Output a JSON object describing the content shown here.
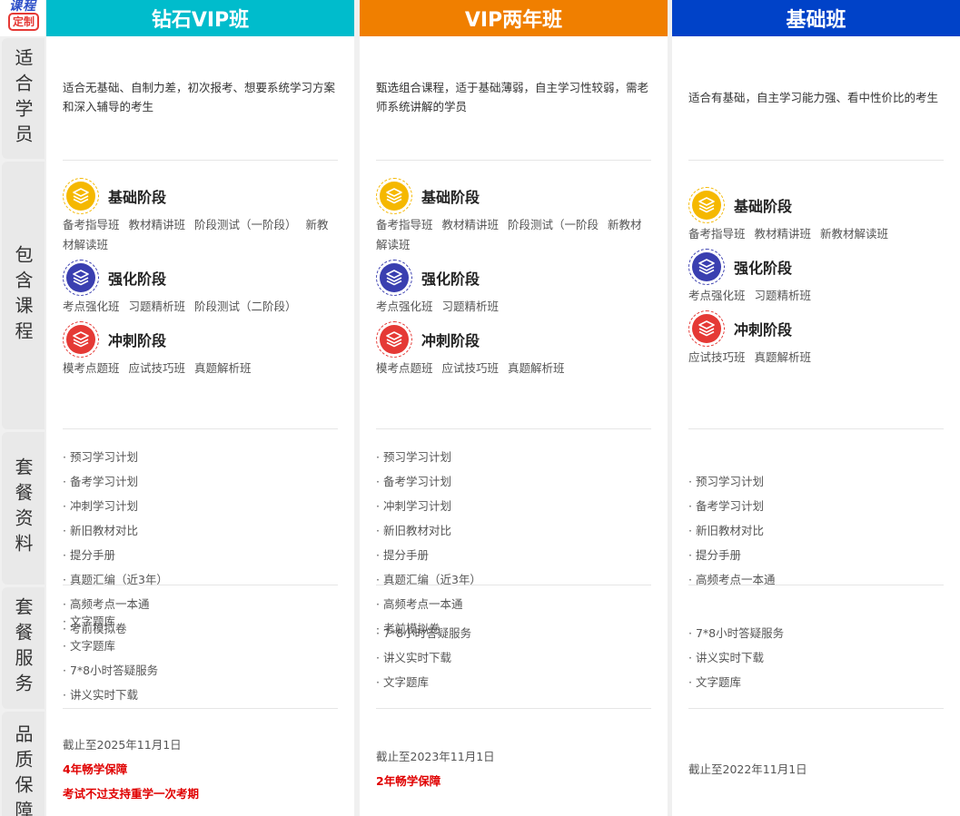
{
  "logo": {
    "top": "课程",
    "badge": "定制"
  },
  "row_labels": [
    "适合学员",
    "包含课程",
    "套餐资料",
    "套餐服务",
    "品质保障"
  ],
  "colors": {
    "diamond": "#00bccc",
    "vip": "#f07f00",
    "basic": "#0042c8",
    "stage1": "#f5b800",
    "stage2": "#3a3fb0",
    "stage3": "#e53935"
  },
  "plans": [
    {
      "name": "钻石VIP班",
      "desc": "适合无基础、自制力差，初次报考、想要系统学习方案和深入辅导的考生",
      "stages": [
        {
          "title": "基础阶段",
          "courses": [
            "备考指导班",
            "教材精讲班",
            "阶段测试（一阶段）",
            "新教材解读班"
          ]
        },
        {
          "title": "强化阶段",
          "courses": [
            "考点强化班",
            "习题精析班",
            "阶段测试（二阶段）"
          ]
        },
        {
          "title": "冲刺阶段",
          "courses": [
            "模考点题班",
            "应试技巧班",
            "真题解析班"
          ]
        }
      ],
      "materials": [
        "· 预习学习计划",
        "· 备考学习计划",
        "· 冲刺学习计划",
        "· 新旧教材对比",
        "· 提分手册",
        "",
        "· 真题汇编（近3年）",
        "",
        "· 高频考点一本通",
        "· 考前模拟卷"
      ],
      "services": [
        "· 文字题库",
        "· 文字题库",
        "· 7*8小时答疑服务",
        "",
        "· 讲义实时下载",
        ""
      ],
      "quality": {
        "date": "截止至2025年11月1日",
        "red1": "4年畅学保障",
        "red2": "考试不过支持重学一次考期"
      }
    },
    {
      "name": "VIP两年班",
      "desc": "甄选组合课程，适于基础薄弱，自主学习性较弱，需老师系统讲解的学员",
      "stages": [
        {
          "title": "基础阶段",
          "courses": [
            "备考指导班",
            "教材精讲班",
            "阶段测试（一阶段",
            "新教材解读班"
          ]
        },
        {
          "title": "强化阶段",
          "courses": [
            "考点强化班",
            "习题精析班"
          ]
        },
        {
          "title": "冲刺阶段",
          "courses": [
            "模考点题班",
            "应试技巧班",
            "真题解析班"
          ]
        }
      ],
      "materials": [
        "· 预习学习计划",
        "· 备考学习计划",
        "· 冲刺学习计划",
        "· 新旧教材对比",
        "· 提分手册",
        "",
        "· 真题汇编（近3年）",
        "",
        "· 高频考点一本通",
        "· 考前模拟卷"
      ],
      "services": [
        "· 7*8小时答疑服务",
        "",
        "· 讲义实时下载",
        "· 文字题库"
      ],
      "quality": {
        "date": "截止至2023年11月1日",
        "red1": "2年畅学保障",
        "red2": ""
      }
    },
    {
      "name": "基础班",
      "desc": "适合有基础，自主学习能力强、看中性价比的考生",
      "stages": [
        {
          "title": "基础阶段",
          "courses": [
            "备考指导班",
            "教材精讲班",
            "新教材解读班"
          ]
        },
        {
          "title": "强化阶段",
          "courses": [
            "考点强化班",
            "习题精析班"
          ]
        },
        {
          "title": "冲刺阶段",
          "courses": [
            "应试技巧班",
            "真题解析班"
          ]
        }
      ],
      "materials": [
        "· 预习学习计划",
        "· 备考学习计划",
        "· 新旧教材对比",
        "· 提分手册",
        "· 高频考点一本通",
        ""
      ],
      "services": [
        "· 7*8小时答疑服务",
        "",
        "· 讲义实时下载",
        "· 文字题库"
      ],
      "quality": {
        "date": "截止至2022年11月1日",
        "red1": "",
        "red2": ""
      }
    }
  ],
  "icons": {
    "stage": "layers-icon"
  }
}
